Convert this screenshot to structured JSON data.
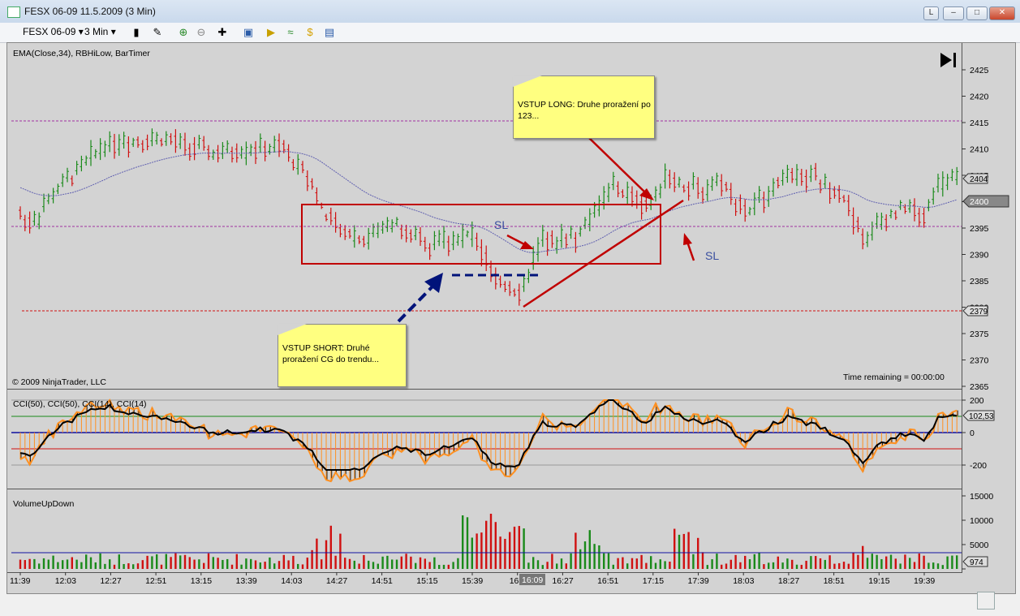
{
  "window": {
    "title": "FESX 06-09  11.5.2009 (3 Min)",
    "btn_l": "L"
  },
  "toolbar": {
    "instrument": "FESX 06-09",
    "interval": "3 Min"
  },
  "chart": {
    "indicator_label": "EMA(Close,34), RBHiLow, BarTimer",
    "copyright": "© 2009 NinjaTrader, LLC",
    "time_remaining": "Time remaining = 00:00:00",
    "price_ticks": [
      "2425",
      "2420",
      "2415",
      "2410",
      "2405",
      "2400",
      "2395",
      "2390",
      "2385",
      "2380",
      "2375",
      "2370",
      "2365"
    ],
    "price_markers": {
      "ema": "2404",
      "last": "2400",
      "low": "2379"
    },
    "cci_label": "CCI(50), CCI(50), CCI(14), CCI(14)",
    "cci_ticks": [
      "200",
      "0",
      "-200"
    ],
    "cci_marker": "102,53",
    "volume_label": "VolumeUpDown",
    "volume_ticks": [
      "15000",
      "10000",
      "5000",
      "0"
    ],
    "volume_marker": "974",
    "time_ticks": [
      "11:39",
      "12:03",
      "12:27",
      "12:51",
      "13:15",
      "13:39",
      "14:03",
      "14:27",
      "14:51",
      "15:15",
      "15:39",
      "16:03",
      "16:27",
      "16:51",
      "17:15",
      "17:39",
      "18:03",
      "18:27",
      "18:51",
      "19:15",
      "19:39"
    ],
    "time_cursor": "16:09",
    "annotations": {
      "long_note": "VSTUP LONG: Druhe proražení po 123...",
      "short_note": "VSTUP SHORT: Druhé proražení CG do trendu...",
      "sl_1": "SL",
      "sl_2": "SL"
    },
    "colors": {
      "up_bar": "#1a8a1a",
      "down_bar": "#d01010",
      "ema": "#6060b0",
      "cci_fast": "#ff9020",
      "cci_slow": "#000000"
    }
  }
}
